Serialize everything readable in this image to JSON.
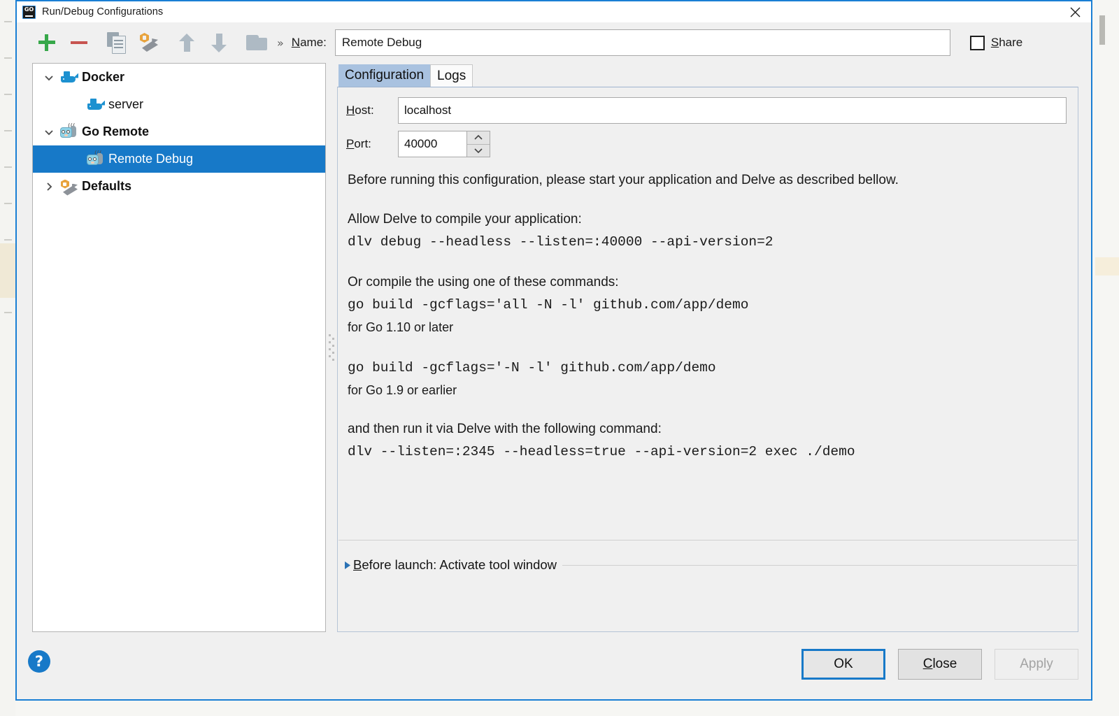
{
  "window": {
    "title": "Run/Debug Configurations",
    "app_icon": "go-logo-icon",
    "close_icon": "close-icon"
  },
  "toolbar": {
    "icons": [
      {
        "name": "add-configuration-button",
        "icon": "plus-icon"
      },
      {
        "name": "remove-configuration-button",
        "icon": "minus-icon"
      },
      {
        "name": "copy-configuration-button",
        "icon": "copy-icon"
      },
      {
        "name": "edit-defaults-button",
        "icon": "wrench-icon"
      },
      {
        "name": "move-up-button",
        "icon": "arrow-up-icon"
      },
      {
        "name": "move-down-button",
        "icon": "arrow-down-icon"
      },
      {
        "name": "create-folder-button",
        "icon": "folder-icon"
      }
    ],
    "overflow_label": "»",
    "name_label_prefix": "N",
    "name_label_rest": "ame:",
    "name_value": "Remote Debug",
    "name_placeholder": "",
    "share_label_prefix": "S",
    "share_label_rest": "hare",
    "share_checked": false
  },
  "tree": {
    "items": [
      {
        "label": "Docker",
        "icon": "docker-whale-icon",
        "twisty": "expanded",
        "depth": 0,
        "bold": true,
        "selected": false
      },
      {
        "label": "server",
        "icon": "docker-whale-icon",
        "twisty": "none",
        "depth": 1,
        "bold": false,
        "selected": false
      },
      {
        "label": "Go Remote",
        "icon": "go-remote-icon",
        "twisty": "expanded",
        "depth": 0,
        "bold": true,
        "selected": false
      },
      {
        "label": "Remote Debug",
        "icon": "go-remote-icon",
        "twisty": "none",
        "depth": 1,
        "bold": false,
        "selected": true
      },
      {
        "label": "Defaults",
        "icon": "defaults-wrench-icon",
        "twisty": "collapsed",
        "depth": 0,
        "bold": true,
        "selected": false
      }
    ]
  },
  "tabs": [
    {
      "label": "Configuration",
      "active": true
    },
    {
      "label": "Logs",
      "active": false
    }
  ],
  "config": {
    "host_label_prefix": "H",
    "host_label_rest": "ost:",
    "host_value": "localhost",
    "port_label_prefix": "P",
    "port_label_rest": "ort:",
    "port_value": "40000",
    "description": {
      "intro": "Before running this configuration, please start your application and Delve as described bellow.",
      "allow_heading": "Allow Delve to compile your application:",
      "allow_command": "dlv debug --headless --listen=:40000 --api-version=2",
      "compile_heading": "Or compile the using one of these commands:",
      "compile_command_1": "go build -gcflags='all -N -l' github.com/app/demo",
      "compile_note_1": "for Go 1.10 or later",
      "compile_command_2": "go build -gcflags='-N -l' github.com/app/demo",
      "compile_note_2": "for Go 1.9 or earlier",
      "run_heading": "and then run it via Delve with the following command:",
      "run_command": "dlv --listen=:2345 --headless=true --api-version=2 exec ./demo"
    },
    "before_launch_prefix": "B",
    "before_launch_rest": "efore launch: Activate tool window"
  },
  "footer": {
    "help_label": "?",
    "ok_label": "OK",
    "close_label_prefix": "C",
    "close_label_rest": "lose",
    "apply_label": "Apply",
    "apply_enabled": false
  },
  "colors": {
    "accent": "#1779c8",
    "selection": "#1779c8",
    "active_tab": "#a9c2e0",
    "add_green": "#37a84a",
    "remove_red": "#c75450",
    "docker_blue": "#1d91d0",
    "dialog_bg": "#f0f0f0"
  }
}
